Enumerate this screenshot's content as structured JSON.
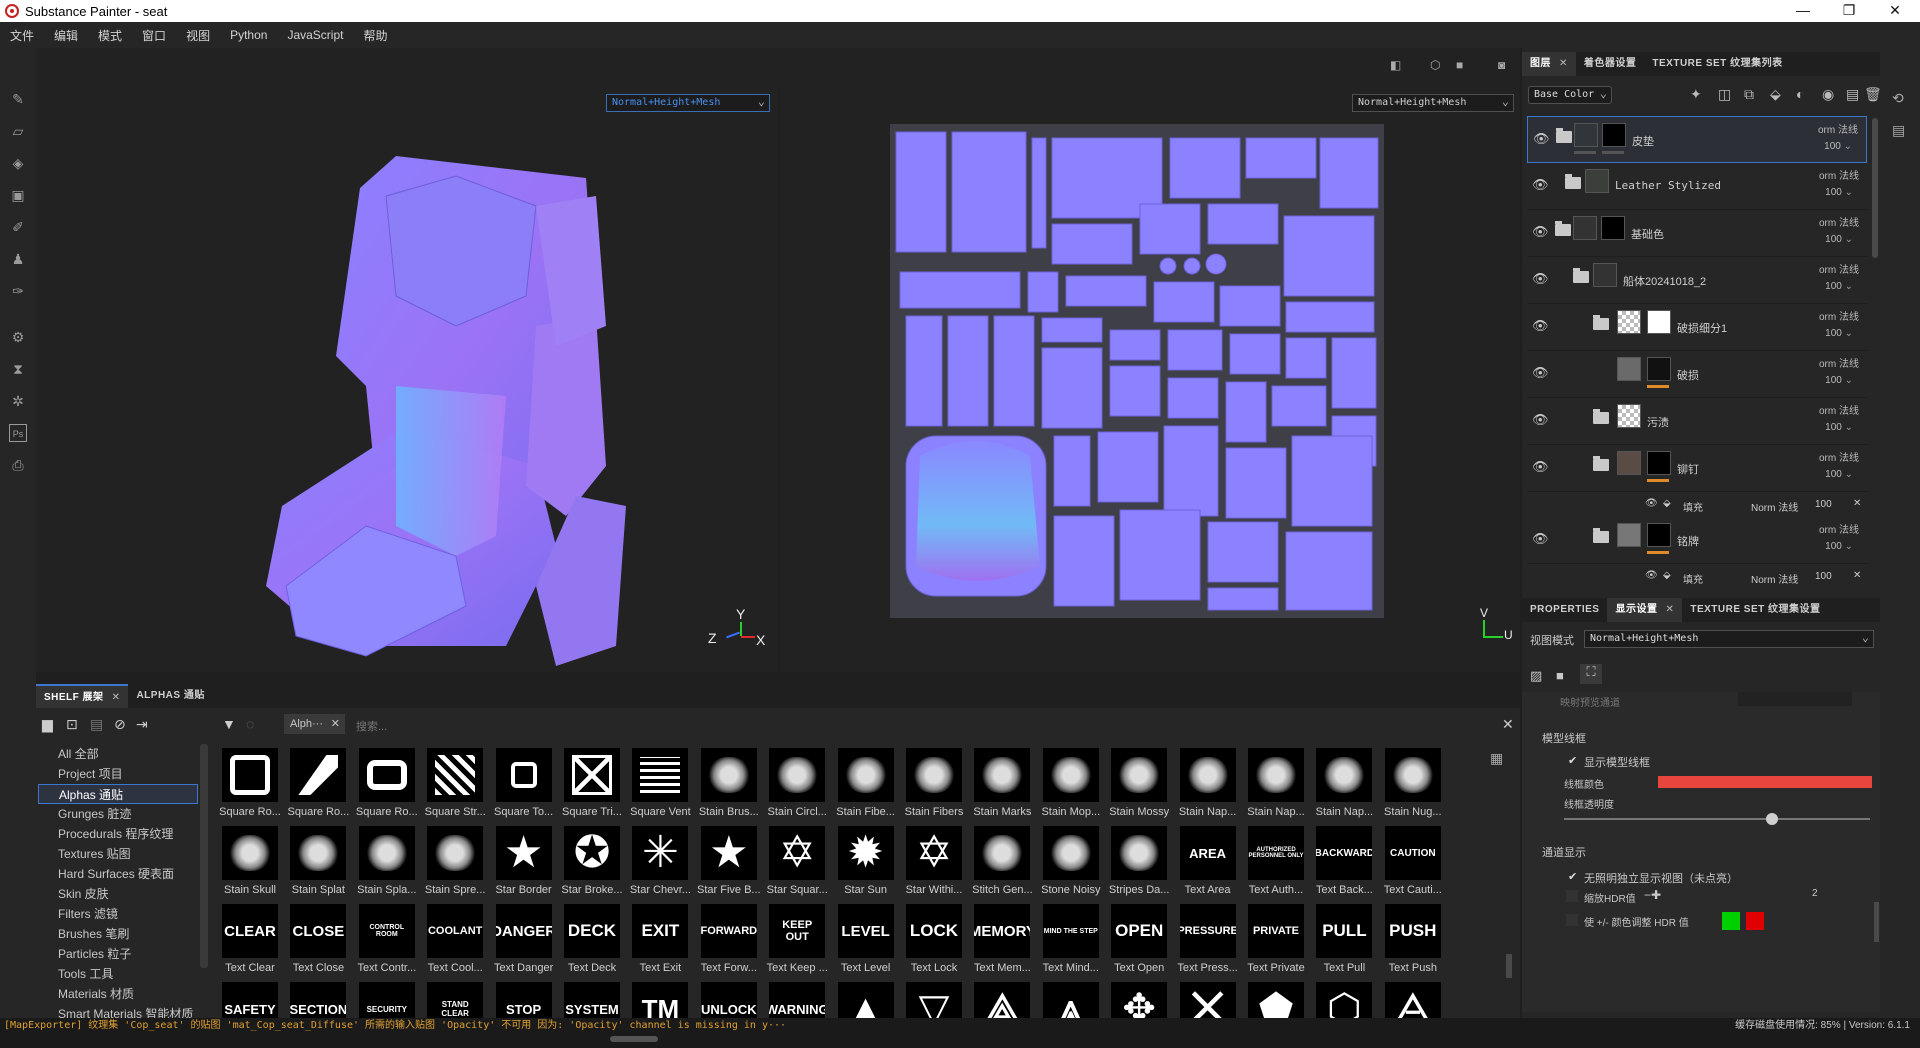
{
  "window": {
    "title": "Substance Painter - seat"
  },
  "menu": [
    "文件",
    "编辑",
    "模式",
    "窗口",
    "视图",
    "Python",
    "JavaScript",
    "帮助"
  ],
  "viewport": {
    "mode_3d": "Normal+Height+Mesh",
    "mode_2d": "Normal+Height+Mesh",
    "axis_labels": {
      "y": "Y",
      "z": "Z",
      "x": "X",
      "v": "V",
      "u": "U"
    }
  },
  "layers_panel": {
    "tabs": [
      {
        "label": "图层",
        "close": "✕"
      },
      {
        "label": "着色器设置"
      },
      {
        "label": "TEXTURE SET 纹理集列表"
      }
    ],
    "channel": "Base Color",
    "layers": [
      {
        "name": "皮垫",
        "blend": "orm 法线",
        "opacity": "100"
      },
      {
        "name": "Leather Stylized",
        "blend": "orm 法线",
        "opacity": "100"
      },
      {
        "name": "基础色",
        "blend": "orm 法线",
        "opacity": "100"
      },
      {
        "name": "船体20241018_2",
        "blend": "orm 法线",
        "opacity": "100"
      },
      {
        "name": "破损细分1",
        "blend": "orm 法线",
        "opacity": "100"
      },
      {
        "name": "破损",
        "blend": "orm 法线",
        "opacity": "100"
      },
      {
        "name": "污渍",
        "blend": "orm 法线",
        "opacity": "100"
      },
      {
        "name": "铆钉",
        "blend": "orm 法线",
        "opacity": "100"
      },
      {
        "name": "铭牌",
        "blend": "orm 法线",
        "opacity": "100"
      }
    ],
    "fill": {
      "label": "填充",
      "blend": "Norm 法线",
      "opacity": "100"
    }
  },
  "display_panel": {
    "tabs": [
      {
        "label": "PROPERTIES"
      },
      {
        "label": "显示设置",
        "close": "✕"
      },
      {
        "label": "TEXTURE SET 纹理集设置"
      }
    ],
    "view_mode_label": "视图模式",
    "view_mode": "Normal+Height+Mesh",
    "clipped_label": "映射预览通道",
    "wireframe_section": "模型线框",
    "show_wireframe": "显示模型线框",
    "wireframe_color_label": "线框颜色",
    "wireframe_color": "#e8453c",
    "wireframe_opacity_label": "线框透明度",
    "wireframe_opacity": 0.68,
    "channel_section": "通道显示",
    "unlit": "无照明独立显示视图（未点亮）",
    "hdr_label": "缩放HDR值",
    "hdr_value": "2",
    "color_adjust": "使 +/- 颜色调整 HDR 值",
    "green": "#00d000",
    "red": "#e00000"
  },
  "shelf": {
    "tabs": [
      {
        "label": "SHELF 展架",
        "close": "✕"
      },
      {
        "label": "ALPHAS 通贴"
      }
    ],
    "filter_chip": "Alph···",
    "search_placeholder": "搜索...",
    "categories": [
      "All 全部",
      "Project 项目",
      "Alphas 通贴",
      "Grunges 脏迹",
      "Procedurals 程序纹理",
      "Textures 贴图",
      "Hard Surfaces 硬表面",
      "Skin 皮肤",
      "Filters 滤镜",
      "Brushes 笔刷",
      "Particles 粒子",
      "Tools 工具",
      "Materials 材质",
      "Smart Materials 智能材质"
    ],
    "row1": [
      "Square Ro...",
      "Square Ro...",
      "Square Ro...",
      "Square Str...",
      "Square To...",
      "Square Tri...",
      "Square Vent",
      "Stain Brus...",
      "Stain Circl...",
      "Stain Fibe...",
      "Stain Fibers",
      "Stain Marks",
      "Stain Mop...",
      "Stain Mossy",
      "Stain Nap...",
      "Stain Nap...",
      "Stain Nap...",
      "Stain Nug..."
    ],
    "row2": [
      "Stain Skull",
      "Stain Splat",
      "Stain Spla...",
      "Stain Spre...",
      "Star Border",
      "Star Broke...",
      "Star Chevr...",
      "Star Five B...",
      "Star Squar...",
      "Star Sun",
      "Star Withi...",
      "Stitch Gen...",
      "Stone Noisy",
      "Stripes Da...",
      "Text Area",
      "Text Auth...",
      "Text Back...",
      "Text Cauti..."
    ],
    "row2_words": {
      "14": "AREA",
      "15": "AUTHORIZED PERSONNEL ONLY",
      "16": "BACKWARD",
      "17": "CAUTION"
    },
    "row3": [
      "Text Clear",
      "Text Close",
      "Text Contr...",
      "Text Cool...",
      "Text Danger",
      "Text Deck",
      "Text Exit",
      "Text Forw...",
      "Text Keep ...",
      "Text Level",
      "Text Lock",
      "Text Mem...",
      "Text Mind...",
      "Text Open",
      "Text Press...",
      "Text Private",
      "Text Pull",
      "Text Push"
    ],
    "row3_words": [
      "CLEAR",
      "CLOSE",
      "CONTROL ROOM",
      "COOLANT",
      "DANGER",
      "DECK",
      "EXIT",
      "FORWARD",
      "KEEP OUT",
      "LEVEL",
      "LOCK",
      "MEMORY",
      "MIND THE STEP",
      "OPEN",
      "PRESSURE",
      "PRIVATE",
      "PULL",
      "PUSH"
    ],
    "row4_words": [
      "SAFETY",
      "SECTION",
      "SECURITY",
      "STAND CLEAR",
      "STOP",
      "SYSTEM",
      "TM",
      "UNLOCK",
      "WARNING"
    ]
  },
  "status": {
    "log": "[MapExporter] 纹理集 'Cop_seat' 的贴图 'mat_Cop_seat_Diffuse' 所需的输入贴图 'Opacity' 不可用 因为: 'Opacity' channel is missing in y···",
    "cache": "缓存磁盘使用情况:  85%  |  Version: 6.1.1"
  }
}
